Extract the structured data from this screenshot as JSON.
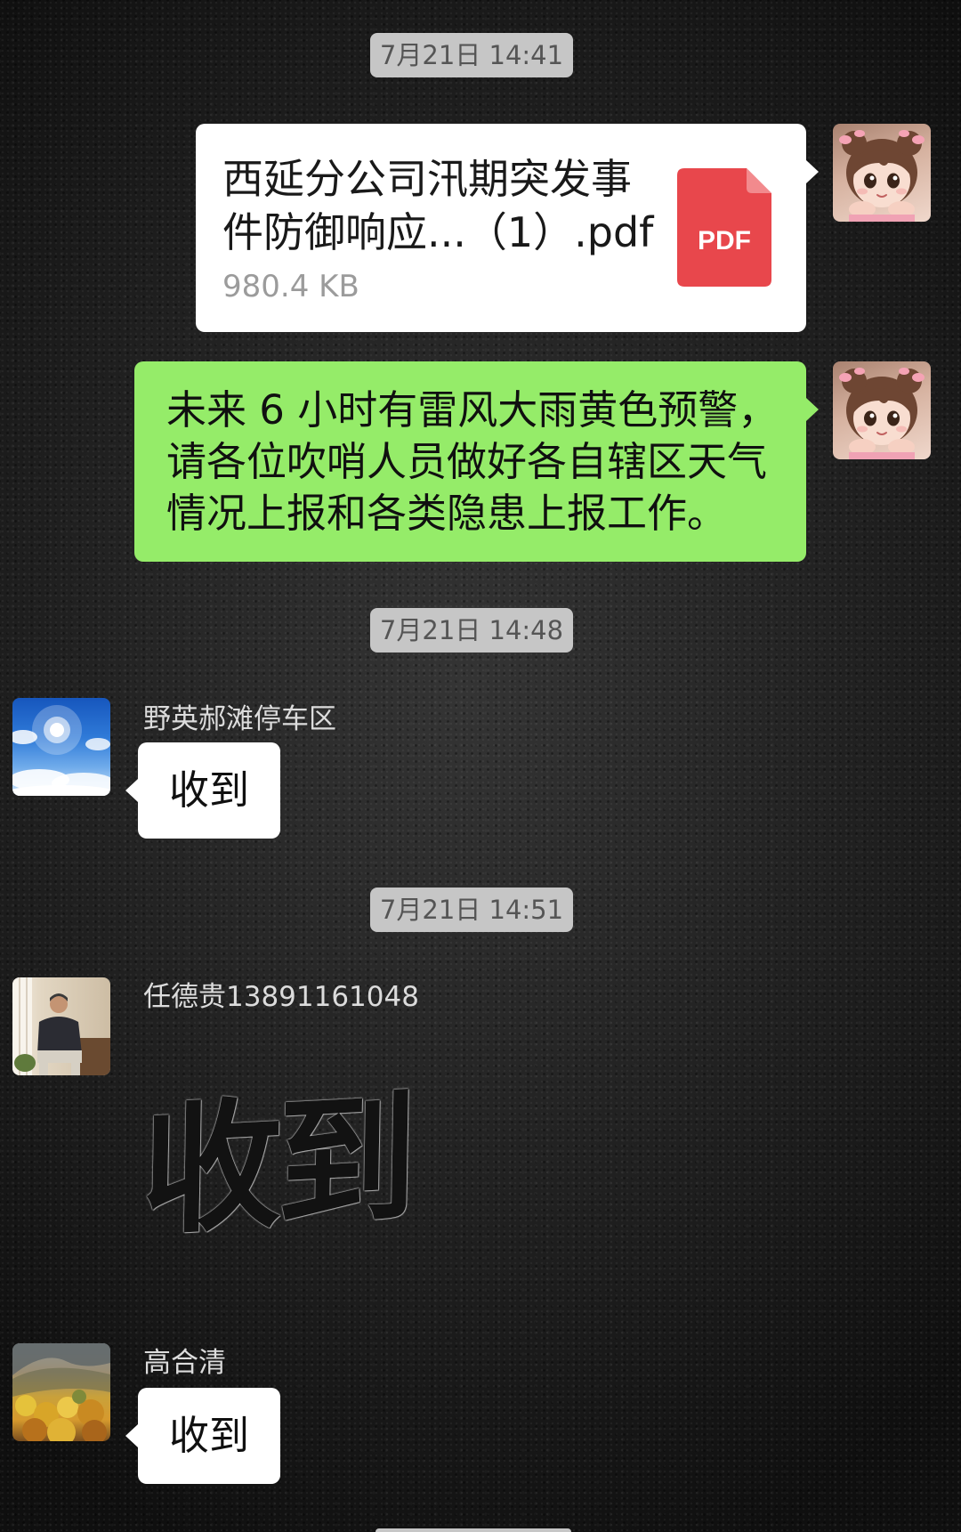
{
  "colors": {
    "background": "#1d1d1d",
    "outgoing_bubble": "#95ec69",
    "incoming_bubble": "#ffffff",
    "timestamp_pill": "#c6c6c6",
    "pdf_icon": "#e8474c"
  },
  "chat": {
    "timestamps": [
      "7月21日 14:41",
      "7月21日 14:48",
      "7月21日 14:51"
    ],
    "outgoing": {
      "file": {
        "name_lines": [
          "西延分公司汛期突发事",
          "件防御响应...（1）.pdf"
        ],
        "size": "980.4 KB",
        "icon": "pdf-file-icon",
        "icon_label": "PDF"
      },
      "text_lines": [
        "未来 6 小时有雷风大雨黄色预警，",
        "请各位吹哨人员做好各自辖区天气",
        "情况上报和各类隐患上报工作。"
      ]
    },
    "incoming": [
      {
        "sender": "野英郝滩停车区",
        "text": "收到"
      },
      {
        "sender": "任德贵13891161048",
        "sticker_text": "收到"
      },
      {
        "sender": "高合清",
        "text": "收到"
      }
    ]
  }
}
